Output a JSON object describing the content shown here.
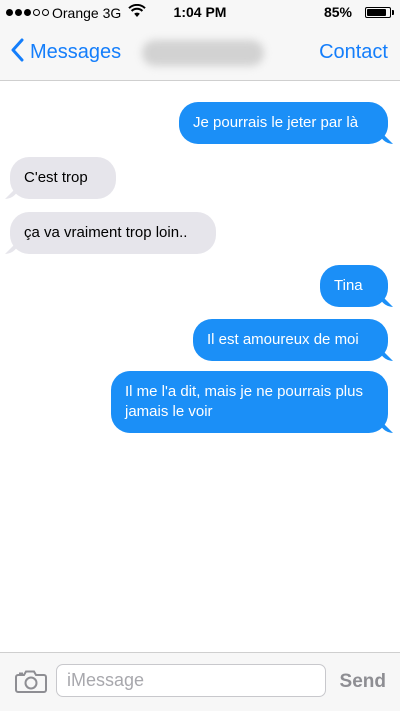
{
  "status_bar": {
    "signal_dots": [
      true,
      true,
      true,
      false,
      false
    ],
    "carrier": "Orange 3G",
    "time": "1:04 PM",
    "battery": "85%",
    "battery_level": 0.85,
    "icons": [
      "signal-dots-icon",
      "wifi-icon",
      "battery-icon"
    ]
  },
  "nav": {
    "back_label": "Messages",
    "contact_label": "Contact",
    "icons": [
      "chevron-left-icon"
    ]
  },
  "messages": [
    {
      "direction": "out",
      "text": "Je pourrais le jeter par là"
    },
    {
      "direction": "in",
      "text": "C'est trop"
    },
    {
      "direction": "in",
      "text": "ça va vraiment trop loin.."
    },
    {
      "direction": "out",
      "text": "Tina"
    },
    {
      "direction": "out",
      "text": "Il est amoureux de moi"
    },
    {
      "direction": "out",
      "text": "Il me l'a dit, mais je ne pourrais plus jamais le voir"
    }
  ],
  "composer": {
    "placeholder": "iMessage",
    "value": "",
    "send_label": "Send",
    "icons": [
      "camera-icon"
    ]
  },
  "colors": {
    "accent": "#147efb",
    "outgoing_bubble": "#1b8ff7",
    "incoming_bubble": "#e6e5eb",
    "send_disabled": "#8e8e93"
  }
}
